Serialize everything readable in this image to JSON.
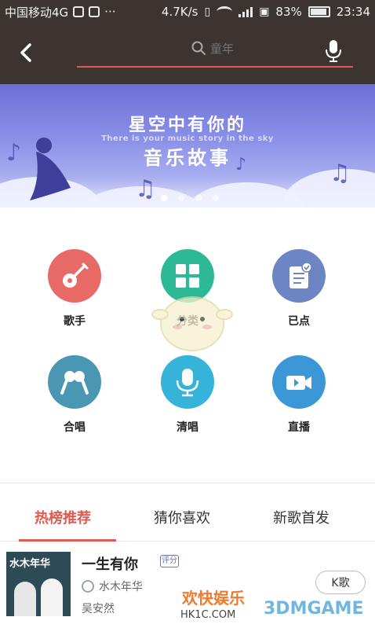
{
  "status_bar": {
    "carrier": "中国移动4G",
    "more": "···",
    "speed": "4.7K/s",
    "battery_percent": "83%",
    "time": "23:34"
  },
  "search": {
    "placeholder": "童年"
  },
  "banner": {
    "title_line1": "星空中有你的",
    "subtitle": "There is your music story in the sky",
    "title_line2": "音乐故事",
    "active_index": 0
  },
  "functions": [
    {
      "label": "歌手",
      "icon": "guitar-icon",
      "color": "#e76a66"
    },
    {
      "label": "分类",
      "icon": "category-grid-icon",
      "color": "#2eb996"
    },
    {
      "label": "已点",
      "icon": "checklist-icon",
      "color": "#6d85c3"
    },
    {
      "label": "合唱",
      "icon": "duet-microphone-icon",
      "color": "#4a97b4"
    },
    {
      "label": "清唱",
      "icon": "microphone-icon",
      "color": "#35b3d8"
    },
    {
      "label": "直播",
      "icon": "video-camera-icon",
      "color": "#3b97d6"
    }
  ],
  "tabs": [
    {
      "label": "热榜推荐",
      "active": true
    },
    {
      "label": "猜你喜欢",
      "active": false
    },
    {
      "label": "新歌首发",
      "active": false
    }
  ],
  "song": {
    "album_title": "水木年华",
    "title": "一生有你",
    "badge": "评分",
    "artist": "水木年华",
    "subtitle": "吴安然",
    "action": "K歌"
  },
  "watermarks": {
    "site": "欢快娱乐",
    "domain": "HK1C.COM",
    "brand": "3DMGAME"
  },
  "colors": {
    "accent": "#e05a4f",
    "header_bg": "#3b3430"
  }
}
